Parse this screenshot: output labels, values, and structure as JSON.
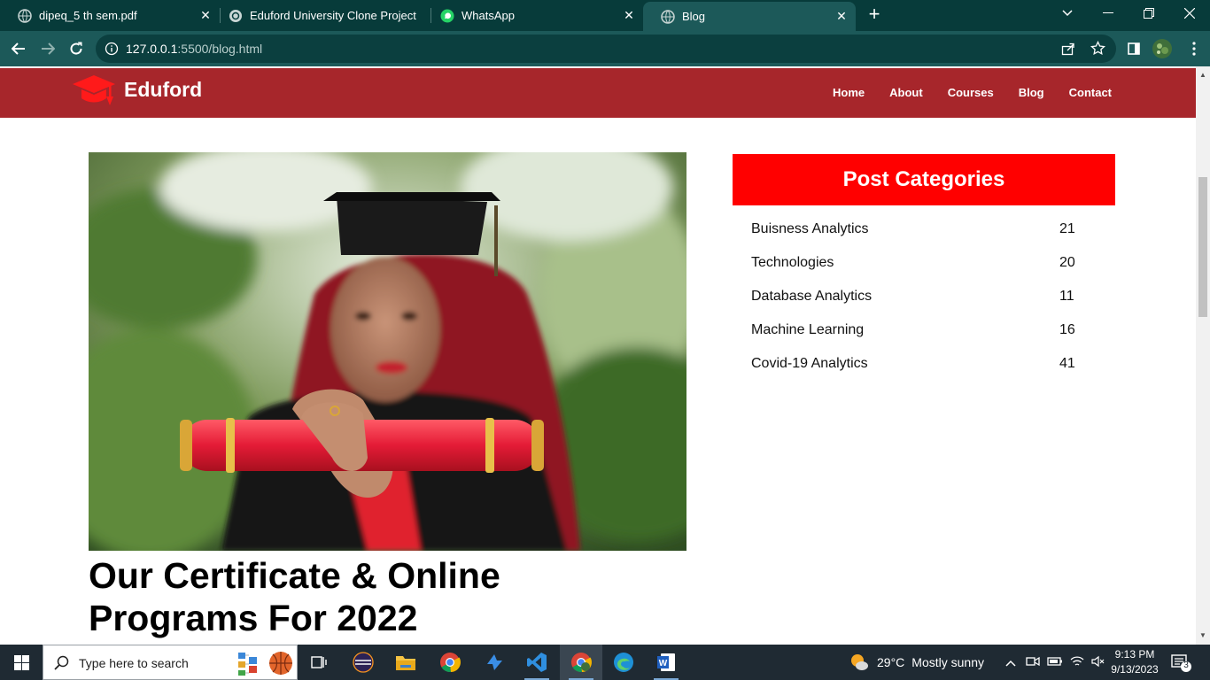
{
  "browser": {
    "tabs": [
      {
        "title": "dipeq_5 th sem.pdf",
        "icon": "globe-icon",
        "active": false
      },
      {
        "title": "Eduford University Clone Project",
        "icon": "chatgpt-icon",
        "active": false
      },
      {
        "title": "WhatsApp",
        "icon": "whatsapp-icon",
        "active": false
      },
      {
        "title": "Blog",
        "icon": "globe-icon",
        "active": true
      }
    ],
    "url_host": "127.0.0.1",
    "url_rest": ":5500/blog.html"
  },
  "site": {
    "brand": "Eduford",
    "nav": [
      "Home",
      "About",
      "Courses",
      "Blog",
      "Contact"
    ],
    "accent": "#a7262b"
  },
  "post": {
    "title_line1": "Our Certificate & Online",
    "title_line2": "Programs For 2022"
  },
  "categories": {
    "heading": "Post Categories",
    "items": [
      {
        "name": "Buisness Analytics",
        "count": "21"
      },
      {
        "name": "Technologies",
        "count": "20"
      },
      {
        "name": "Database Analytics",
        "count": "11"
      },
      {
        "name": "Machine Learning",
        "count": "16"
      },
      {
        "name": "Covid-19 Analytics",
        "count": "41"
      }
    ],
    "header_color": "#ff0000"
  },
  "taskbar": {
    "search_placeholder": "Type here to search",
    "weather_temp": "29°C",
    "weather_text": "Mostly sunny",
    "time": "9:13 PM",
    "date": "9/13/2023",
    "notifications": "3"
  }
}
